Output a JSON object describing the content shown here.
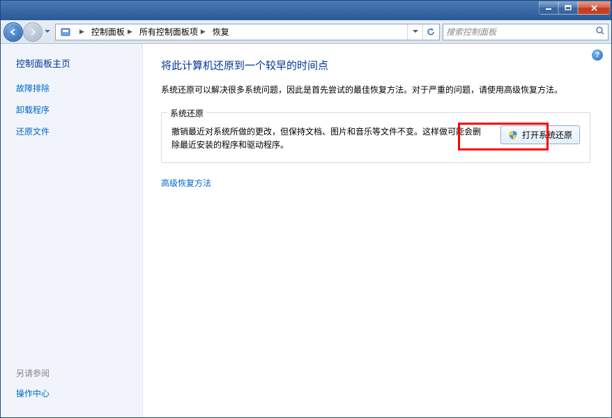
{
  "titlebar": {
    "minimize": "minimize",
    "maximize": "maximize",
    "close": "close"
  },
  "breadcrumb": {
    "items": [
      "控制面板",
      "所有控制面板项",
      "恢复"
    ]
  },
  "search": {
    "placeholder": "搜索控制面板"
  },
  "sidebar": {
    "title": "控制面板主页",
    "links": [
      "故障排除",
      "卸载程序",
      "还原文件"
    ],
    "see_also_label": "另请参阅",
    "see_also_links": [
      "操作中心"
    ]
  },
  "content": {
    "title": "将此计算机还原到一个较早的时间点",
    "description": "系统还原可以解决很多系统问题，因此是首先尝试的最佳恢复方法。对于严重的问题，请使用高级恢复方法。",
    "restore_section": {
      "legend": "系统还原",
      "text": "撤销最近对系统所做的更改，但保持文档、图片和音乐等文件不变。这样做可能会删除最近安装的程序和驱动程序。",
      "button_label": "打开系统还原"
    },
    "advanced_link": "高级恢复方法"
  },
  "help_tooltip": "?"
}
